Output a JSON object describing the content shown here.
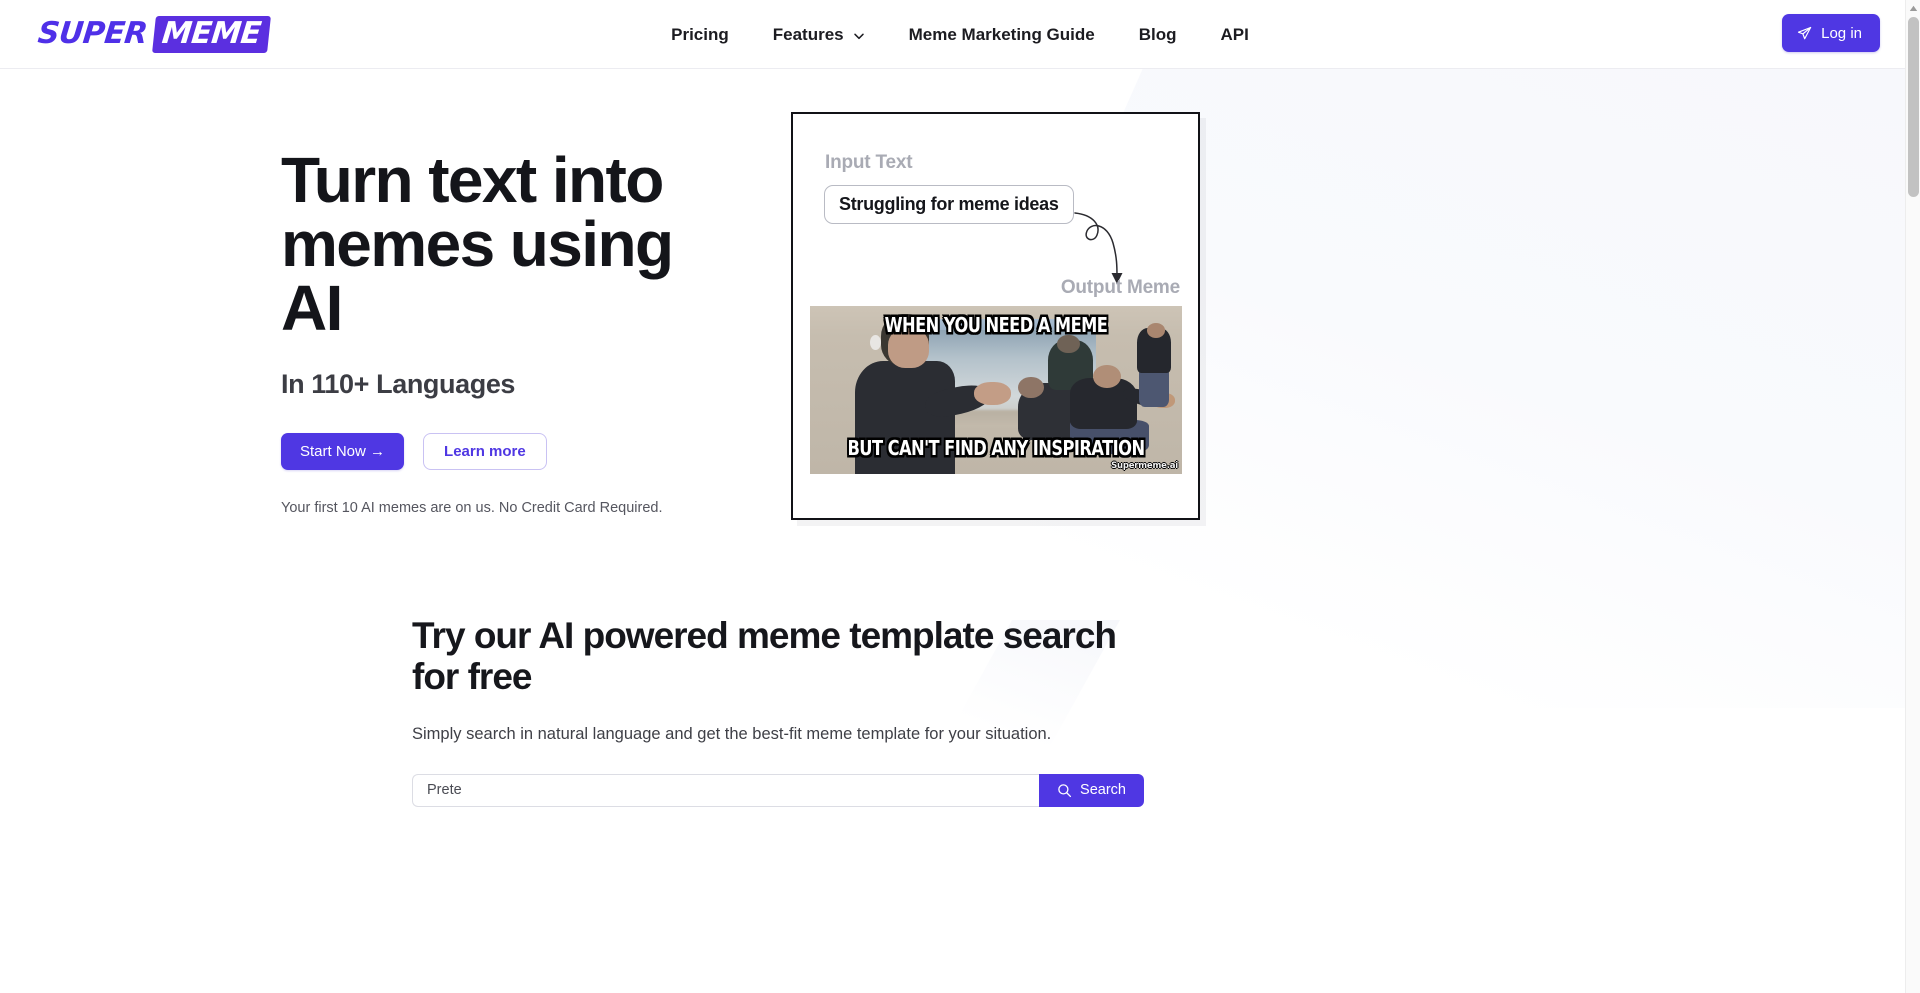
{
  "brand": {
    "logo_primary": "SUPER",
    "logo_secondary": "MEME",
    "accent_color": "#4f37e3",
    "logo_box_color": "#5b2fe0"
  },
  "header": {
    "nav_items": [
      {
        "label": "Pricing",
        "has_dropdown": false
      },
      {
        "label": "Features",
        "has_dropdown": true,
        "icon": "chevron-down-icon"
      },
      {
        "label": "Meme Marketing Guide",
        "has_dropdown": false
      },
      {
        "label": "Blog",
        "has_dropdown": false
      },
      {
        "label": "API",
        "has_dropdown": false
      }
    ],
    "login_label": "Log in",
    "login_icon": "paper-plane-icon"
  },
  "hero": {
    "title": "Turn text into memes using AI",
    "subtitle": "In 110+ Languages",
    "primary_cta": "Start Now →",
    "secondary_cta": "Learn more",
    "note": "Your first 10 AI memes are on us. No Credit Card Required."
  },
  "demo": {
    "input_label": "Input Text",
    "input_value": "Struggling for meme ideas",
    "output_label": "Output Meme",
    "meme_top_text": "WHEN YOU NEED A MEME",
    "meme_bottom_text": "BUT CAN'T FIND ANY INSPIRATION",
    "watermark": "Supermeme.ai"
  },
  "search_section": {
    "title": "Try our AI powered meme template search for free",
    "subtitle": "Simply search in natural language and get the best-fit meme template for your situation.",
    "input_value": "Prete",
    "input_placeholder": "Prete",
    "button_label": "Search",
    "button_icon": "search-icon"
  },
  "scrollbar": {
    "up_arrow_icon": "scroll-up-arrow-icon"
  }
}
